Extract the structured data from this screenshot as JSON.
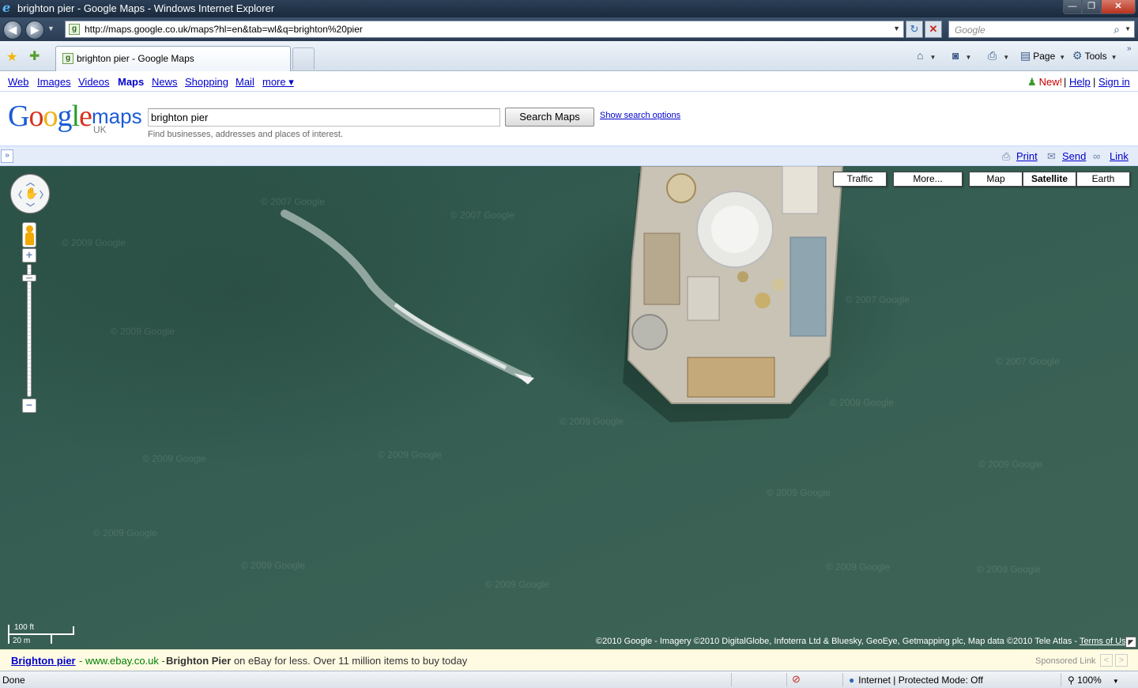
{
  "window": {
    "title": "brighton pier - Google Maps - Windows Internet Explorer",
    "min": "—",
    "max": "❐",
    "close": "✕"
  },
  "navbar": {
    "url": "http://maps.google.co.uk/maps?hl=en&tab=wl&q=brighton%20pier",
    "search_placeholder": "Google"
  },
  "tabs": [
    {
      "label": "brighton pier - Google Maps",
      "active": true
    }
  ],
  "commandbar": {
    "page_label": "Page",
    "tools_label": "Tools"
  },
  "gbar": {
    "links": [
      "Web",
      "Images",
      "Videos",
      "Maps",
      "News",
      "Shopping",
      "Mail",
      "more ▾"
    ],
    "current": "Maps",
    "new_label": "New!",
    "help_label": "Help",
    "signin_label": "Sign in"
  },
  "search": {
    "logo_text": "Google",
    "logo_maps": "maps",
    "logo_region": "UK",
    "query": "brighton pier",
    "button_label": "Search Maps",
    "options_link": "Show search options",
    "hint": "Find businesses, addresses and places of interest."
  },
  "map_toolbar": {
    "print": "Print",
    "send": "Send",
    "link": "Link"
  },
  "map": {
    "type_buttons": [
      {
        "label": "Traffic",
        "selected": false
      },
      {
        "label": "More...",
        "selected": false
      },
      {
        "label": "Map",
        "selected": false
      },
      {
        "label": "Satellite",
        "selected": true
      },
      {
        "label": "Earth",
        "selected": false
      }
    ],
    "scale_imperial": "100 ft",
    "scale_metric": "20 m",
    "copyright": "©2010 Google - Imagery ©2010 DigitalGlobe, Infoterra Ltd & Bluesky, GeoEye, Getmapping plc, Map data ©2010 Tele Atlas - ",
    "terms_link": "Terms of Use",
    "watermarks": [
      "© 2007 Google",
      "© 2009 Google"
    ]
  },
  "ad": {
    "title": "Brighton pier",
    "url": " - www.ebay.co.uk - ",
    "body_bold": "Brighton Pier",
    "body": " on eBay for less. Over 11 million items to buy today",
    "sponsored_label": "Sponsored Link",
    "prev": "<",
    "next": ">"
  },
  "statusbar": {
    "status": "Done",
    "zone": "Internet | Protected Mode: Off",
    "zoom": "100%"
  }
}
